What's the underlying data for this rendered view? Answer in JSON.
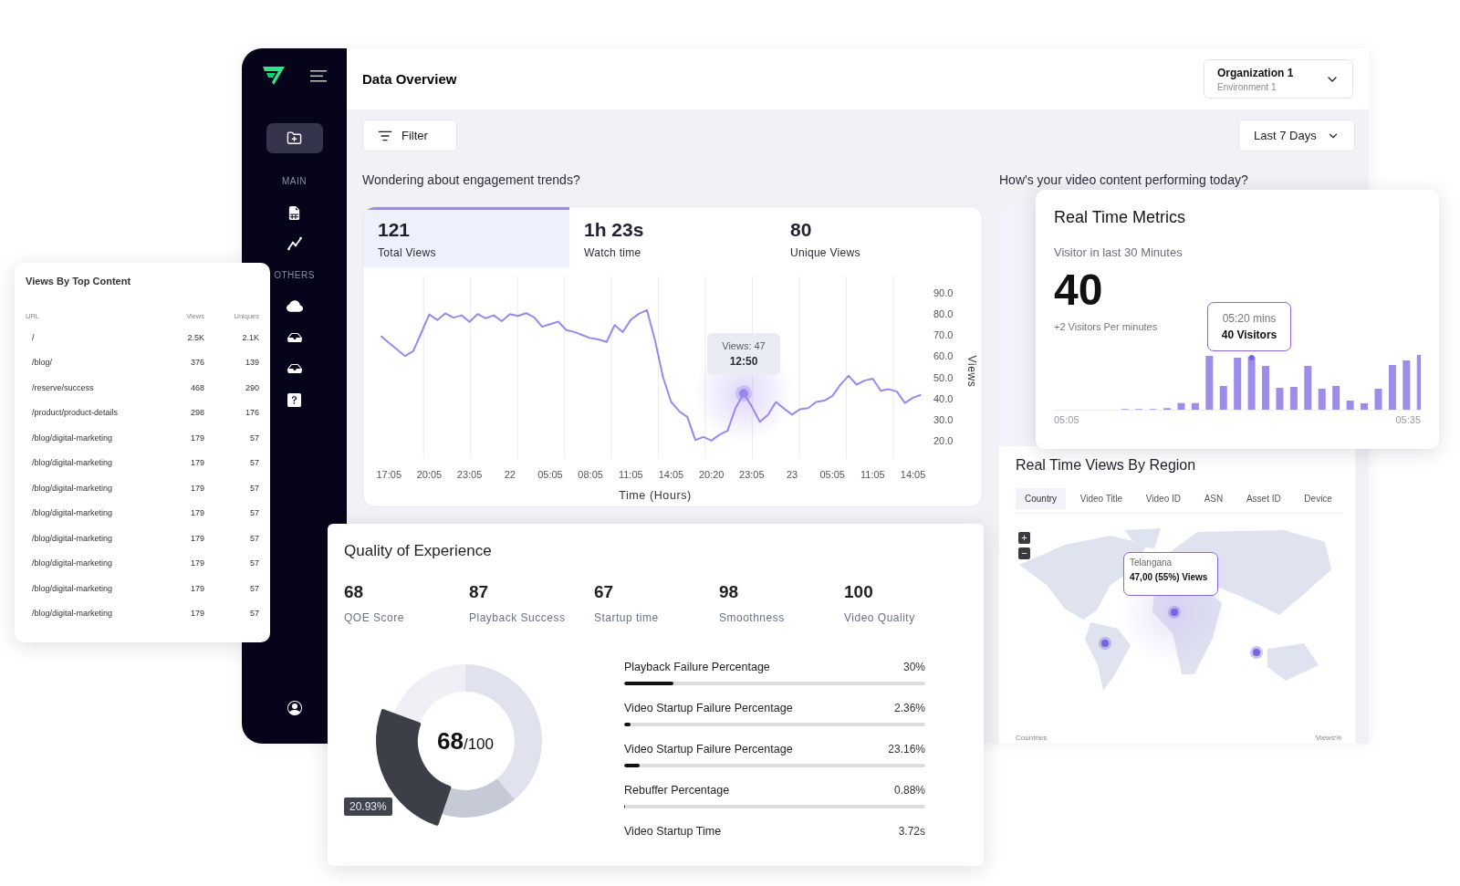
{
  "sidebar": {
    "sections": [
      {
        "label": "MAIN"
      },
      {
        "label": "OTHERS"
      }
    ]
  },
  "header": {
    "title": "Data Overview",
    "organization": {
      "name": "Organization 1",
      "environment": "Environment 1"
    }
  },
  "toolbar": {
    "filter": "Filter",
    "date_range": "Last 7 Days"
  },
  "engagement": {
    "question": "Wondering about engagement trends?",
    "tooltip": {
      "label": "Views: 47",
      "time": "12:50"
    },
    "stats": [
      {
        "value": "121",
        "label": "Total Views",
        "selected": true
      },
      {
        "value": "1h 23s",
        "label": "Watch time",
        "selected": false
      },
      {
        "value": "80",
        "label": "Unique Views",
        "selected": false
      }
    ],
    "chart_data": {
      "type": "line",
      "xlabel": "Time (Hours)",
      "ylabel": "Views",
      "ylim": [
        11.4,
        98
      ],
      "categories": [
        null,
        "17:05",
        null,
        null,
        null,
        null,
        "20:05",
        null,
        null,
        null,
        null,
        "23:05",
        null,
        null,
        null,
        null,
        "22",
        null,
        null,
        null,
        null,
        "05:05",
        null,
        null,
        null,
        null,
        "08:05",
        null,
        null,
        null,
        null,
        "11:05",
        null,
        null,
        null,
        null,
        "14:05",
        null,
        null,
        null,
        null,
        "20:20",
        null,
        null,
        null,
        null,
        "23:05",
        null,
        null,
        null,
        null,
        "23",
        null,
        null,
        null,
        null,
        "05:05",
        null,
        null,
        null,
        null,
        "11:05",
        null,
        null,
        null,
        null,
        "14:05",
        null
      ],
      "yticks": [
        {
          "value": 20,
          "label": "20.0"
        },
        {
          "value": 30,
          "label": "30.0"
        },
        {
          "value": 40,
          "label": "40.0"
        },
        {
          "value": 50,
          "label": "50.0"
        },
        {
          "value": 60,
          "label": "60.0"
        },
        {
          "value": 70,
          "label": "70.0"
        },
        {
          "value": 80,
          "label": "80.0"
        },
        {
          "value": 90,
          "label": "90.0"
        }
      ],
      "series": [
        {
          "color": "#9a88ec",
          "values": [
            69.6,
            66.4,
            63.2,
            60.1,
            62.4,
            71,
            79.8,
            77.2,
            80.3,
            78.3,
            79.4,
            76.3,
            80,
            78,
            79.4,
            76.6,
            80,
            79.1,
            80.4,
            78.5,
            74,
            75.2,
            76.4,
            72.4,
            71.5,
            70,
            68.6,
            68,
            66.8,
            74.8,
            71.5,
            77.3,
            80.1,
            81.9,
            67.6,
            50.2,
            38.4,
            34,
            31.3,
            20.4,
            21.8,
            20.1,
            22.9,
            24.7,
            35.6,
            42.4,
            36.3,
            29,
            32.2,
            38.4,
            35.3,
            32.4,
            35,
            35.5,
            38.4,
            39,
            41.3,
            46.5,
            50.8,
            46.6,
            48.5,
            49.4,
            43.7,
            44.4,
            43.3,
            37.9,
            40.4,
            41.7
          ]
        }
      ]
    }
  },
  "video": {
    "question": "How's your video content performing today?",
    "region": {
      "title": "Real Time Views By Region",
      "tabs": [
        {
          "label": "Country",
          "selected": true
        },
        {
          "label": "Video Title",
          "selected": false
        },
        {
          "label": "Video ID",
          "selected": false
        },
        {
          "label": "ASN",
          "selected": false
        },
        {
          "label": "Asset ID",
          "selected": false
        },
        {
          "label": "Device",
          "selected": false
        }
      ],
      "zoom_in": "+",
      "zoom_out": "−",
      "tooltip": {
        "place": "Telangana",
        "views": "47,00 (55%) Views"
      },
      "footer": [
        "Countries",
        "Views%"
      ]
    }
  },
  "real_time_metrics": {
    "title": "Real Time Metrics",
    "subtitle": "Visitor in last 30 Minutes",
    "value": "40",
    "rate": "+2 Visitors Per minutes",
    "tooltip": {
      "time": "05:20 mins",
      "visitors": "40 Visitors"
    },
    "axis": [
      "05:05",
      "05:35"
    ]
  },
  "top_content": {
    "title": "Views By Top Content",
    "columns": [
      "URL",
      "Views",
      "Uniques"
    ],
    "rows": [
      [
        "/",
        "2.5K",
        "2.1K"
      ],
      [
        "/blog/",
        "376",
        "139"
      ],
      [
        "/reserve/success",
        "468",
        "290"
      ],
      [
        "/product/product-details",
        "298",
        "176"
      ],
      [
        "/blog/digital-marketing",
        "179",
        "57"
      ],
      [
        "/blog/digital-marketing",
        "179",
        "57"
      ],
      [
        "/blog/digital-marketing",
        "179",
        "57"
      ],
      [
        "/blog/digital-marketing",
        "179",
        "57"
      ],
      [
        "/blog/digital-marketing",
        "179",
        "57"
      ],
      [
        "/blog/digital-marketing",
        "179",
        "57"
      ],
      [
        "/blog/digital-marketing",
        "179",
        "57"
      ],
      [
        "/blog/digital-marketing",
        "179",
        "57"
      ]
    ]
  },
  "quality": {
    "title": "Quality of Experience",
    "metrics": [
      {
        "value": "68",
        "label": "QOE Score"
      },
      {
        "value": "87",
        "label": "Playback Success"
      },
      {
        "value": "67",
        "label": "Startup time"
      },
      {
        "value": "98",
        "label": "Smoothness"
      },
      {
        "value": "100",
        "label": "Video Quality"
      }
    ],
    "score": "68",
    "score_max": "/100",
    "slice_label": "20.93%",
    "bars": [
      {
        "kind": "bar",
        "label": "Playback Failure Percentage",
        "reading": "30%",
        "level": 0.165
      },
      {
        "kind": "bar",
        "label": "Video Startup Failure Percentage",
        "reading": "2.36%",
        "level": 0.022
      },
      {
        "kind": "bar",
        "label": "Video Startup Failure Percentage",
        "reading": "23.16%",
        "level": 0.052
      },
      {
        "kind": "bar",
        "label": "Rebuffer Percentage",
        "reading": "0.88%",
        "level": 0.004
      },
      {
        "kind": "plain",
        "label": "Video Startup Time",
        "reading": "3.72s"
      }
    ]
  }
}
